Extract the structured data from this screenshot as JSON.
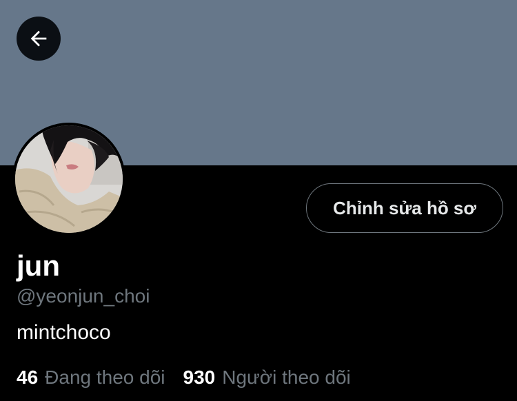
{
  "profile": {
    "banner_color": "#66778a",
    "back_icon": "arrow-left-icon",
    "avatar_alt": "Profile photo",
    "edit_button_label": "Chỉnh sửa hồ sơ",
    "display_name": "jun",
    "handle": "@yeonjun_choi",
    "bio": "mintchoco",
    "stats": {
      "following_count": "46",
      "following_label": "Đang theo dõi",
      "followers_count": "930",
      "followers_label": "Người theo dõi"
    }
  },
  "colors": {
    "background": "#000000",
    "muted_text": "#6e767d",
    "primary_text": "#ffffff"
  }
}
